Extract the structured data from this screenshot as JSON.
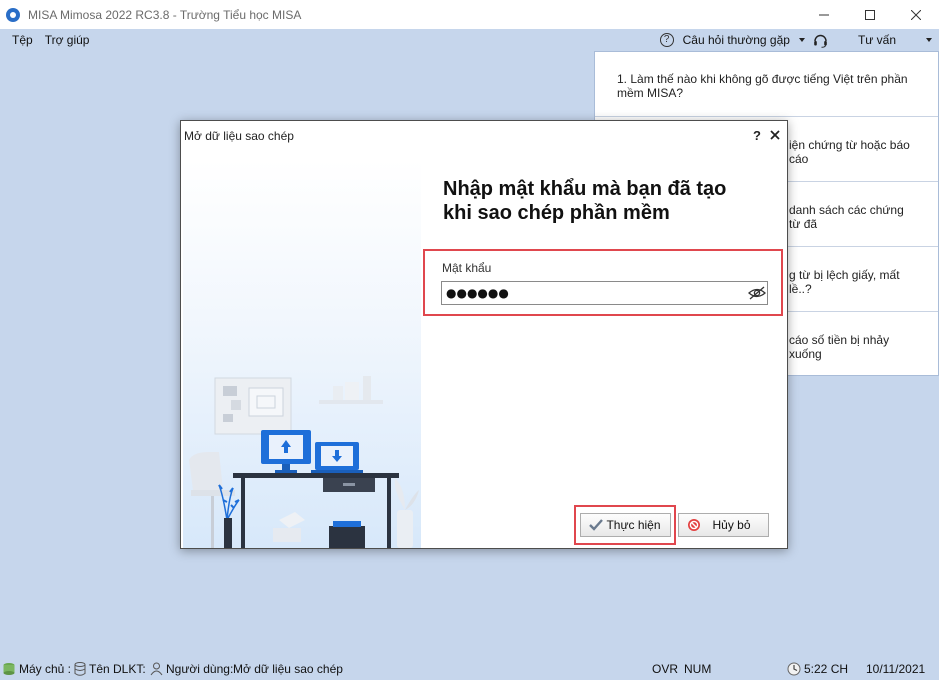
{
  "window": {
    "title": "MISA Mimosa 2022 RC3.8 - Trường Tiểu học MISA"
  },
  "menu": {
    "items": [
      "Tệp",
      "Trợ giúp"
    ],
    "faq_label": "Câu hỏi thường gặp",
    "advice_label": "Tư vấn"
  },
  "faq": {
    "items": [
      "1. Làm thế nào khi không gõ được tiếng Việt trên phần mềm MISA?",
      "iện chứng từ hoặc báo cáo",
      "danh sách các chứng từ đã",
      "g từ bị lệch giấy, mất lề..?",
      "cáo số tiền bị nhảy xuống"
    ]
  },
  "dialog": {
    "title": "Mở dữ liệu sao chép",
    "help_glyph": "?",
    "heading_line1": "Nhập mật khẩu mà bạn đã tạo",
    "heading_line2": "khi sao chép phần mềm",
    "password_label": "Mật khẩu",
    "password_value": "●●●●●●",
    "ok_label": "Thực hiện",
    "cancel_label": "Hủy bỏ"
  },
  "status": {
    "server_label": "Máy chủ :",
    "db_label": "Tên DLKT:",
    "user_label": "Người dùng:",
    "task": "Mở dữ liệu sao chép",
    "ovr": "OVR",
    "num": "NUM",
    "time": "5:22 CH",
    "date": "10/11/2021"
  },
  "colors": {
    "highlight": "#e0474e",
    "background": "#c6d6ec",
    "illustration_blue": "#1e6fd9"
  }
}
